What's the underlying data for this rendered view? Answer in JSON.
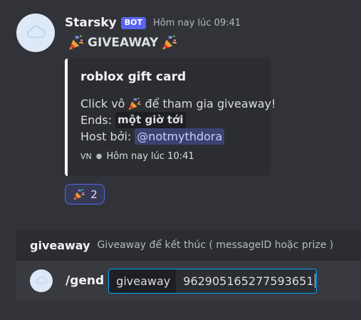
{
  "message": {
    "username": "Starsky",
    "bot_tag": "BOT",
    "timestamp": "Hôm nay lúc 09:41",
    "title": "GIVEAWAY",
    "avatar_icon": "cloud-icon",
    "title_icon": "party-popper-icon"
  },
  "embed": {
    "accent_color": "#ffffff",
    "title": "roblox gift card",
    "line1_prefix": "Click vô",
    "line1_suffix": "để tham gia giveaway!",
    "ends_label": "Ends:",
    "ends_value": "một giờ tới",
    "host_label": "Host bởi:",
    "host_mention": "@notmythdora",
    "footer_tag": "VN",
    "footer_time": "Hôm nay lúc 10:41"
  },
  "reaction": {
    "icon": "party-popper-icon",
    "count": "2"
  },
  "command_hint": {
    "name": "giveaway",
    "description": "Giveaway để kết thúc ( messageID hoặc prize )"
  },
  "input": {
    "command": "/gend",
    "option_name": "giveaway",
    "option_value": "962905165277593651"
  }
}
